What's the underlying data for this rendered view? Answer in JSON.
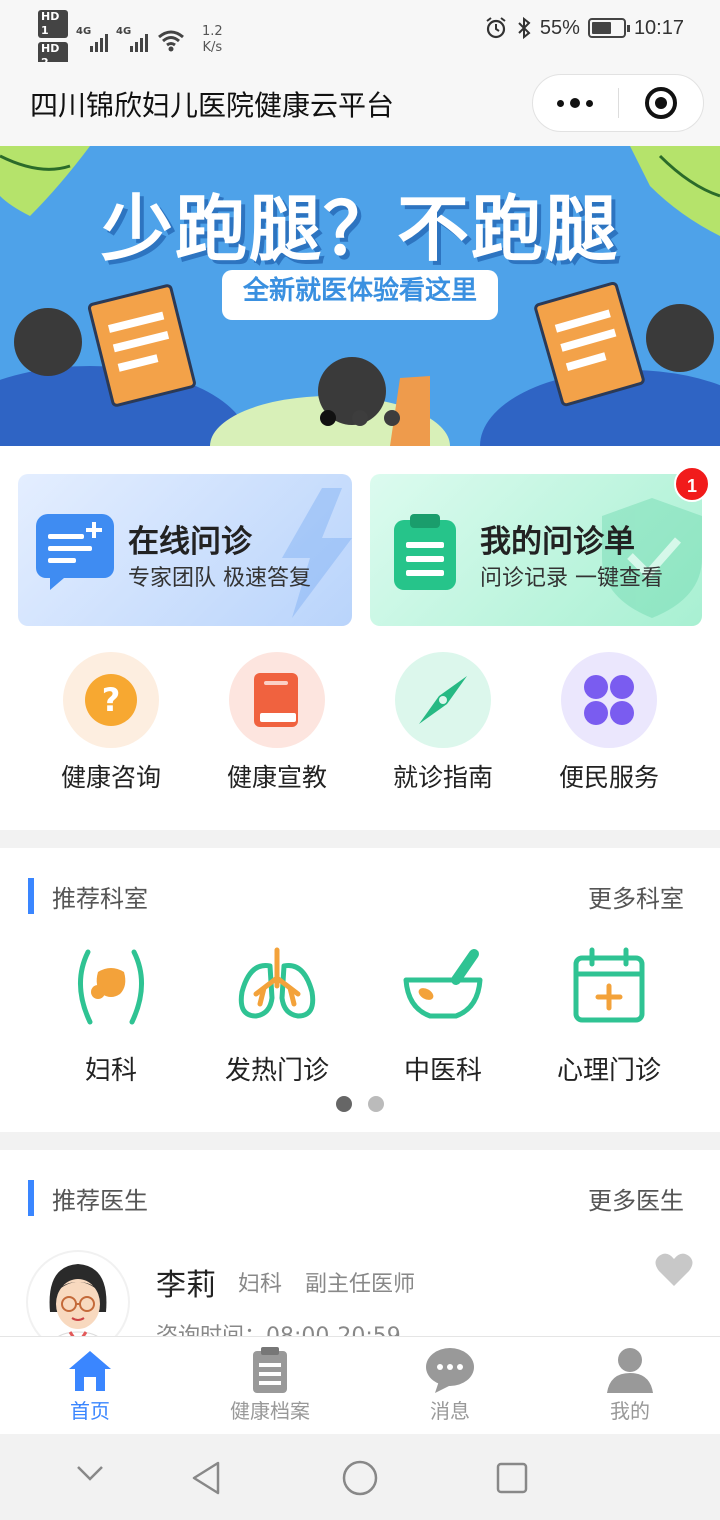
{
  "status_bar": {
    "hd1": "HD 1",
    "hd2": "HD 2",
    "sig1": "4G",
    "sig2": "4G",
    "speed_value": "1.2",
    "speed_unit": "K/s",
    "battery": "55%",
    "time": "10:17"
  },
  "header": {
    "title": "四川锦欣妇儿医院健康云平台"
  },
  "banner": {
    "title": "少跑腿？不跑腿",
    "subtitle": "全新就医体验看这里",
    "slide_count": 3,
    "active_slide": 1,
    "active_color": "#111111",
    "inactive_color": "#3d3d3d"
  },
  "cards": [
    {
      "title": "在线问诊",
      "subtitle": "专家团队 极速答复"
    },
    {
      "title": "我的问诊单",
      "subtitle": "问诊记录 一键查看",
      "badge": "1"
    }
  ],
  "quick_links": [
    {
      "label": "健康咨询",
      "icon": "question-icon"
    },
    {
      "label": "健康宣教",
      "icon": "book-icon"
    },
    {
      "label": "就诊指南",
      "icon": "compass-icon"
    },
    {
      "label": "便民服务",
      "icon": "grid-icon"
    }
  ],
  "departments_section": {
    "title": "推荐科室",
    "more": "更多科室",
    "items": [
      {
        "label": "妇科",
        "icon": "uterus-icon"
      },
      {
        "label": "发热门诊",
        "icon": "lungs-icon"
      },
      {
        "label": "中医科",
        "icon": "mortar-pestle-icon"
      },
      {
        "label": "心理门诊",
        "icon": "calendar-plus-icon"
      }
    ],
    "page_count": 2,
    "active_page": 1
  },
  "doctors_section": {
    "title": "推荐医生",
    "more": "更多医生",
    "doctor": {
      "name": "李莉",
      "department": "妇科",
      "title": "副主任医师",
      "hours": "咨询时间：08:00-20:59"
    }
  },
  "tabbar": {
    "items": [
      {
        "label": "首页",
        "icon": "home-icon",
        "active": true
      },
      {
        "label": "健康档案",
        "icon": "clipboard-icon",
        "active": false
      },
      {
        "label": "消息",
        "icon": "chat-icon",
        "active": false
      },
      {
        "label": "我的",
        "icon": "user-icon",
        "active": false
      }
    ]
  },
  "colors": {
    "accent": "#3a86ff",
    "banner_bg": "#4ea2e9",
    "badge_red": "#f11b1b",
    "icon_green": "#2fc393"
  }
}
